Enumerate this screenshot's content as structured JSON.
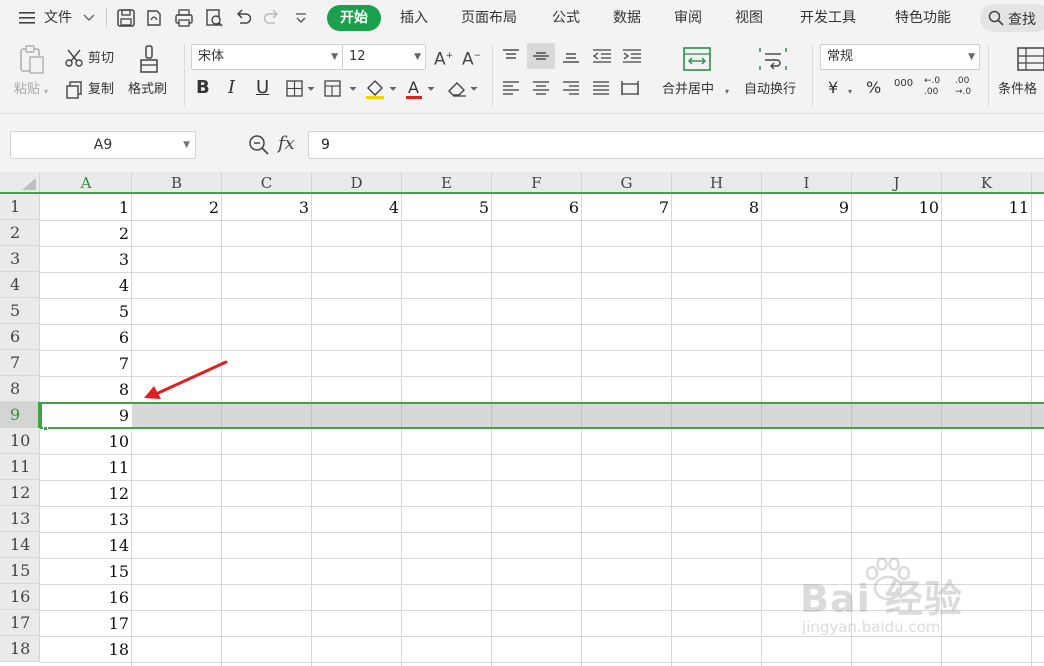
{
  "menubar": {
    "file_label": "文件",
    "tabs": [
      "开始",
      "插入",
      "页面布局",
      "公式",
      "数据",
      "审阅",
      "视图",
      "开发工具",
      "特色功能"
    ],
    "search_label": "查找"
  },
  "ribbon": {
    "paste_label": "粘贴",
    "cut_label": "剪切",
    "copy_label": "复制",
    "format_painter_label": "格式刷",
    "font_name": "宋体",
    "font_size": "12",
    "merge_center_label": "合并居中",
    "wrap_text_label": "自动换行",
    "number_format": "常规",
    "conditional_format_label": "条件格",
    "bold_glyph": "B",
    "italic_glyph": "I",
    "underline_glyph": "U",
    "currency_glyph": "¥",
    "percent_glyph": "%",
    "thousands_glyph": "000",
    "inc_decimal_glyph": "←.0 .00",
    "dec_decimal_glyph": ".00 →.0"
  },
  "formula_bar": {
    "name_box": "A9",
    "fx_label": "fx",
    "value": "9"
  },
  "sheet": {
    "columns": [
      "A",
      "B",
      "C",
      "D",
      "E",
      "F",
      "G",
      "H",
      "I",
      "J",
      "K"
    ],
    "rows": [
      "1",
      "2",
      "3",
      "4",
      "5",
      "6",
      "7",
      "8",
      "9",
      "10",
      "11",
      "12",
      "13",
      "14",
      "15",
      "16",
      "17",
      "18"
    ],
    "row1_values": [
      "1",
      "2",
      "3",
      "4",
      "5",
      "6",
      "7",
      "8",
      "9",
      "10",
      "11"
    ],
    "col_a_values": [
      "1",
      "2",
      "3",
      "4",
      "5",
      "6",
      "7",
      "8",
      "9",
      "10",
      "11",
      "12",
      "13",
      "14",
      "15",
      "16",
      "17",
      "18"
    ],
    "selected_row": "9"
  },
  "colors": {
    "accent_green": "#1a9f4b",
    "selection_green": "#3fa34a",
    "arrow_red": "#e02020"
  },
  "watermark": {
    "text": "Bai 经验",
    "url": "jingyan.baidu.com"
  }
}
